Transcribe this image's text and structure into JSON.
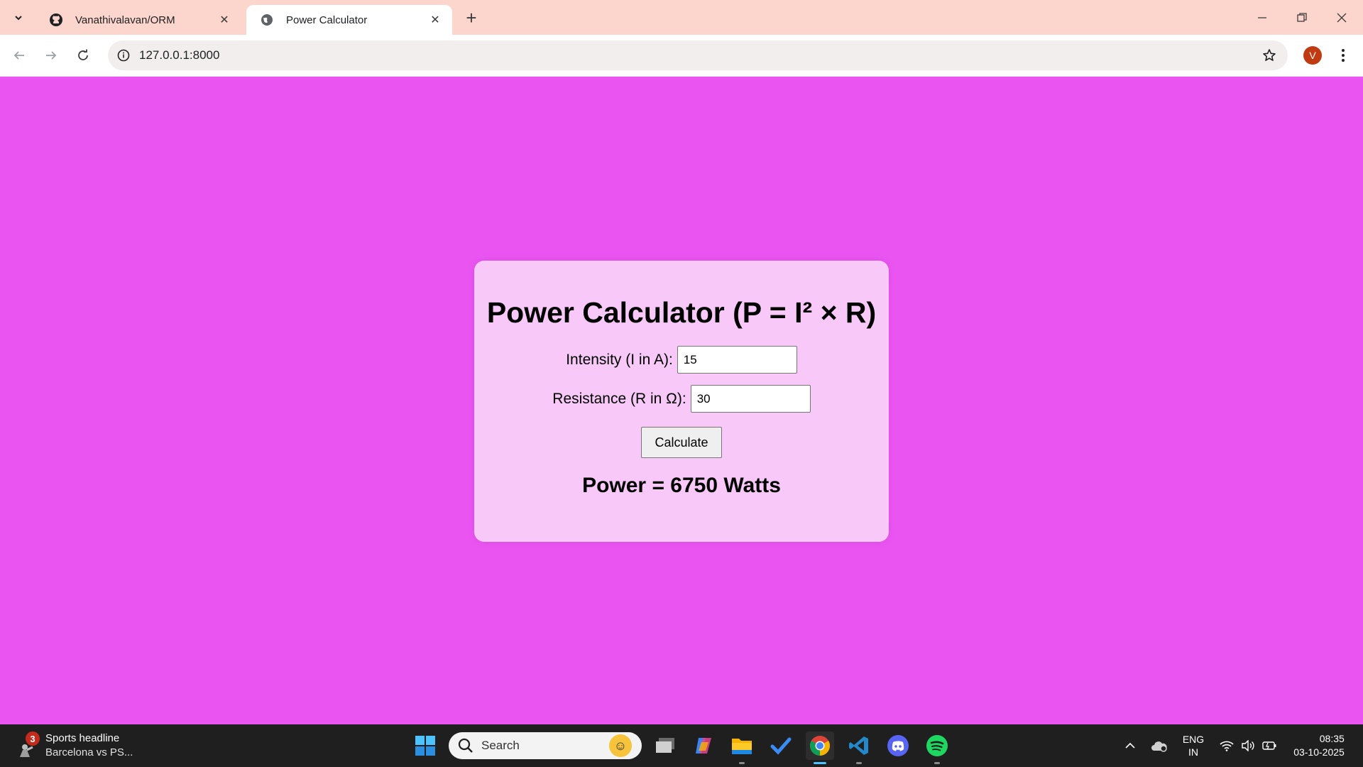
{
  "browser": {
    "tabs": [
      {
        "title": "Vanathivalavan/ORM",
        "favicon": "github-icon",
        "active": false
      },
      {
        "title": "Power Calculator",
        "favicon": "globe-icon",
        "active": true
      }
    ],
    "url": "127.0.0.1:8000",
    "profile_initial": "V"
  },
  "page": {
    "heading": "Power Calculator (P = I² × R)",
    "intensity_label": "Intensity (I in A):",
    "intensity_value": "15",
    "resistance_label": "Resistance (R in Ω):",
    "resistance_value": "30",
    "calculate_label": "Calculate",
    "result": "Power = 6750 Watts",
    "background_color": "#ea55f2",
    "card_color": "#f7c8f8"
  },
  "taskbar": {
    "widget_badge": "3",
    "widget_title": "Sports headline",
    "widget_subtitle": "Barcelona vs PS...",
    "search_placeholder": "Search",
    "pinned_apps": [
      "windows-start-icon",
      "task-view-icon",
      "copilot-icon",
      "file-explorer-icon",
      "todo-icon",
      "chrome-icon",
      "vscode-icon",
      "discord-icon",
      "spotify-icon"
    ],
    "language_line1": "ENG",
    "language_line2": "IN",
    "time": "08:35",
    "date": "03-10-2025"
  }
}
